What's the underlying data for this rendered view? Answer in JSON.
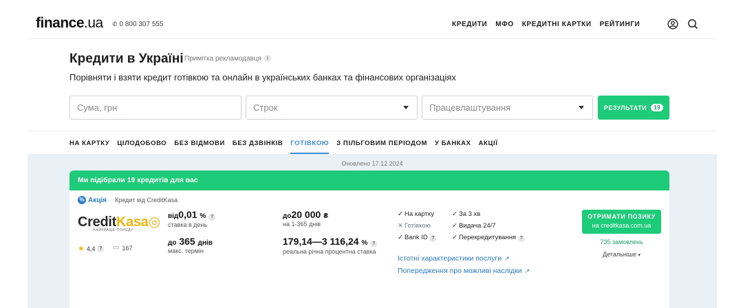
{
  "header": {
    "logo_main": "finance",
    "logo_tld": ".ua",
    "phone": "0 800 307 555",
    "nav": [
      "КРЕДИТИ",
      "МФО",
      "КРЕДИТНІ КАРТКИ",
      "РЕЙТИНГИ"
    ],
    "icons": [
      "user-icon",
      "search-icon"
    ]
  },
  "page": {
    "title": "Кредити в Україні",
    "ad_note": "Примітка рекламодавця",
    "subtitle": "Порівняти і взяти кредит готівкою та онлайн в українських банках та фінансових організаціях"
  },
  "filters": {
    "sum_placeholder": "Сума, грн",
    "term_label": "Строк",
    "employment_label": "Працевлаштування",
    "results_label": "РЕЗУЛЬТАТИ",
    "results_count": "19"
  },
  "tabs": [
    {
      "label": "НА КАРТКУ",
      "active": false
    },
    {
      "label": "ЦІЛОДОБОВО",
      "active": false
    },
    {
      "label": "БЕЗ ВІДМОВИ",
      "active": false
    },
    {
      "label": "БЕЗ ДЗВІНКІВ",
      "active": false
    },
    {
      "label": "ГОТІВКОЮ",
      "active": true
    },
    {
      "label": "З ПІЛЬГОВИМ ПЕРІОДОМ",
      "active": false
    },
    {
      "label": "У БАНКАХ",
      "active": false
    },
    {
      "label": "АКЦІЇ",
      "active": false
    }
  ],
  "results": {
    "updated": "Оновлено 17.12.2024",
    "header": "Ми підібрали 19 кредитів для вас"
  },
  "offer": {
    "promo": "Акція",
    "lender": "Кредит від CreditKasa",
    "brand_credit": "Credit",
    "brand_kasa": "Kasa",
    "brand_tagline": "НАЙКРАЩЕ ПОРЕДУ",
    "rating": "4,4",
    "reviews": "167",
    "rate_prefix": "від",
    "rate_value": "0,01",
    "rate_unit": "%",
    "rate_caption": "ставка в день",
    "term_prefix": "до",
    "term_value": "365",
    "term_unit": "днів",
    "term_caption": "макс. термін",
    "sum_prefix": "до",
    "sum_value": "20 000",
    "sum_unit": "₴",
    "sum_caption": "на 1-365 днів",
    "apr_value": "179,14—3 116,24",
    "apr_unit": "%",
    "apr_caption": "реальна річна процентна ставка",
    "features": [
      {
        "label": "На картку",
        "available": true
      },
      {
        "label": "За 3 хв",
        "available": true
      },
      {
        "label": "Готівкою",
        "available": false
      },
      {
        "label": "Видача 24/7",
        "available": true
      },
      {
        "label": "Bank ID",
        "available": true
      },
      {
        "label": "Перекредитування",
        "available": true
      }
    ],
    "link_characteristics": "Істотні характеристики послуги",
    "link_warnings": "Попередження про можливі наслідки",
    "cta_line1": "ОТРИМАТИ ПОЗИКУ",
    "cta_line2": "на creditkasa.com.ua",
    "orders": "735 замовлень",
    "details": "Детальніше"
  },
  "colors": {
    "accent_green": "#1dcb79",
    "link_blue": "#2a7bd0",
    "brand_yellow": "#f2b411",
    "panel_bg": "#e9f1f7"
  }
}
